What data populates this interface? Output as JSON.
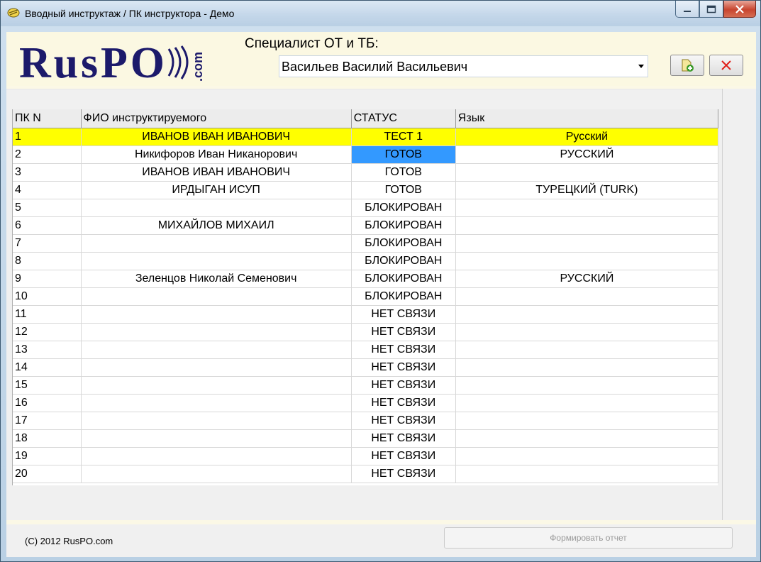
{
  "window": {
    "title": "Вводный инструктаж / ПК инструктора - Демо"
  },
  "header": {
    "specialist_label": "Специалист  ОТ и ТБ:",
    "specialist_selected": "Васильев Василий Васильевич",
    "logo_text": "RusPO",
    "logo_suffix": ".com"
  },
  "colors": {
    "selected_row": "#ffff00",
    "status_ready": "#1515d6",
    "status_offline": "#9a9a9a",
    "highlight_cell": "#3399ff",
    "logo": "#1c1a6b"
  },
  "table": {
    "columns": [
      "ПК N",
      "ФИО  инструктируемого",
      "СТАТУС",
      "Язык"
    ],
    "rows": [
      {
        "n": "1",
        "name": "ИВАНОВ ИВАН ИВАНОВИЧ",
        "status": "ТЕСТ 1",
        "lang": "Русский"
      },
      {
        "n": "2",
        "name": "Никифоров Иван Никанорович",
        "status": "ГОТОВ",
        "lang": "РУССКИЙ"
      },
      {
        "n": "3",
        "name": "ИВАНОВ ИВАН ИВАНОВИЧ",
        "status": "ГОТОВ",
        "lang": ""
      },
      {
        "n": "4",
        "name": "ИРДЫГАН ИСУП",
        "status": "ГОТОВ",
        "lang": "ТУРЕЦКИЙ (TURK)"
      },
      {
        "n": "5",
        "name": "",
        "status": "БЛОКИРОВАН",
        "lang": ""
      },
      {
        "n": "6",
        "name": "МИХАЙЛОВ МИХАИЛ",
        "status": "БЛОКИРОВАН",
        "lang": ""
      },
      {
        "n": "7",
        "name": "",
        "status": "БЛОКИРОВАН",
        "lang": ""
      },
      {
        "n": "8",
        "name": "",
        "status": "БЛОКИРОВАН",
        "lang": ""
      },
      {
        "n": "9",
        "name": "Зеленцов Николай Семенович",
        "status": "БЛОКИРОВАН",
        "lang": "РУССКИЙ"
      },
      {
        "n": "10",
        "name": "",
        "status": "БЛОКИРОВАН",
        "lang": ""
      },
      {
        "n": "11",
        "name": "",
        "status": "НЕТ СВЯЗИ",
        "lang": ""
      },
      {
        "n": "12",
        "name": "",
        "status": "НЕТ СВЯЗИ",
        "lang": ""
      },
      {
        "n": "13",
        "name": "",
        "status": "НЕТ СВЯЗИ",
        "lang": ""
      },
      {
        "n": "14",
        "name": "",
        "status": "НЕТ СВЯЗИ",
        "lang": ""
      },
      {
        "n": "15",
        "name": "",
        "status": "НЕТ СВЯЗИ",
        "lang": ""
      },
      {
        "n": "16",
        "name": "",
        "status": "НЕТ СВЯЗИ",
        "lang": ""
      },
      {
        "n": "17",
        "name": "",
        "status": "НЕТ СВЯЗИ",
        "lang": ""
      },
      {
        "n": "18",
        "name": "",
        "status": "НЕТ СВЯЗИ",
        "lang": ""
      },
      {
        "n": "19",
        "name": "",
        "status": "НЕТ СВЯЗИ",
        "lang": ""
      },
      {
        "n": "20",
        "name": "",
        "status": "НЕТ СВЯЗИ",
        "lang": ""
      }
    ]
  },
  "footer": {
    "copyright": "(С) 2012  RusPO.com",
    "report_button": "Формировать  отчет"
  }
}
